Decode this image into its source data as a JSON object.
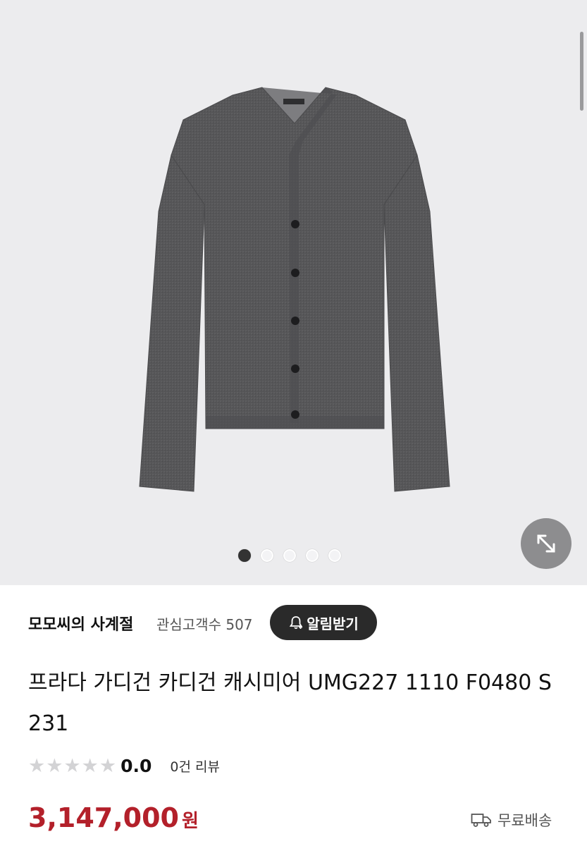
{
  "gallery": {
    "image_alt": "그레이 캐시미어 가디건",
    "dots_total": 5,
    "active_index": 0,
    "expand_icon": "expand-arrows-icon"
  },
  "seller": {
    "name": "모모씨의 사계절",
    "followers_label": "관심고객수 507",
    "follow_button_label": "알림받기",
    "follow_icon": "bell-plus-icon"
  },
  "product": {
    "title": "프라다 가디건 카디건 캐시미어 UMG227 1110 F0480 S 231",
    "rating_value": "0.0",
    "rating_stars": 0,
    "review_label": "0건 리뷰",
    "price": "3,147,000",
    "price_unit": "원",
    "shipping_label": "무료배송",
    "shipping_icon": "truck-icon"
  },
  "colors": {
    "price": "#b3202a",
    "follow_button_bg": "#2a2a2a",
    "gallery_bg": "#ececee",
    "star_empty": "#d3d3d5"
  }
}
